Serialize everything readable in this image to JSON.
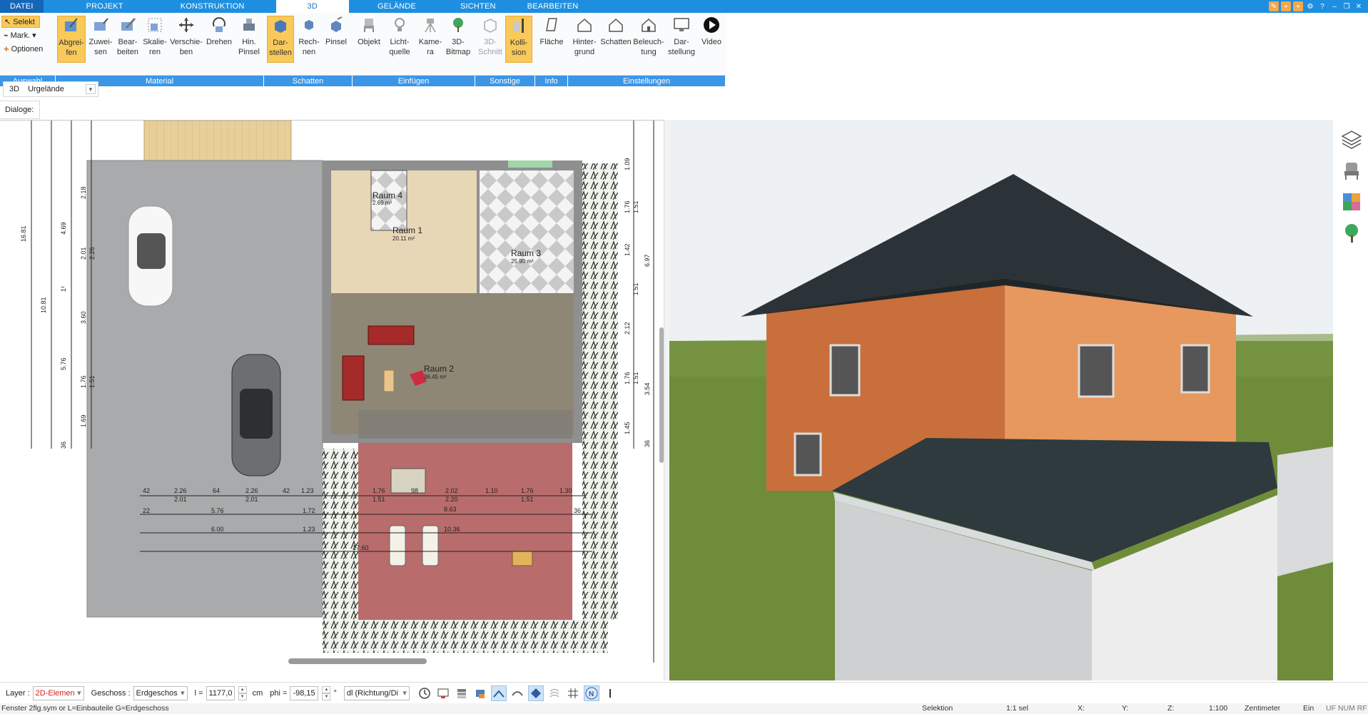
{
  "menu": {
    "tabs": [
      "DATEI",
      "PROJEKT",
      "KONSTRUKTION",
      "3D",
      "GELÄNDE",
      "SICHTEN",
      "BEARBEITEN"
    ],
    "active": "3D"
  },
  "ribbon": {
    "selection": {
      "select": "Selekt",
      "mark": "Mark.",
      "options": "Optionen"
    },
    "buttons": {
      "abgreifen": "Abgrei-\nfen",
      "zuweisen": "Zuwei-\nsen",
      "bearbeiten": "Bear-\nbeiten",
      "skalieren": "Skalie-\nren",
      "verschieben": "Verschie-\nben",
      "drehen": "Drehen",
      "hin_pinsel": "Hin.\nPinsel",
      "darstellen": "Dar-\nstellen",
      "rechnen": "Rech-\nnen",
      "pinsel": "Pinsel",
      "objekt": "Objekt",
      "lichtquelle": "Licht-\nquelle",
      "kamera": "Kame-\nra",
      "bitmap3d": "3D-\nBitmap",
      "schnitt3d": "3D-\nSchnitt",
      "kollision": "Kolli-\nsion",
      "flaeche": "Fläche",
      "hintergrund": "Hinter-\ngrund",
      "schatten": "Schatten",
      "beleuchtung": "Beleuch-\ntung",
      "darstellung": "Dar-\nstellung",
      "video": "Video"
    },
    "groups": {
      "auswahl": "Auswahl",
      "material": "Material",
      "schatten": "Schatten",
      "einfuegen": "Einfügen",
      "sonstige": "Sonstige",
      "info": "Info",
      "einstellungen": "Einstellungen"
    }
  },
  "subbar": {
    "mode": "3D",
    "terrain": "Urgelände",
    "dialoge": "Dialoge:"
  },
  "plan": {
    "rooms": [
      {
        "name": "Raum 4",
        "area": "2.69 m²"
      },
      {
        "name": "Raum 1",
        "area": "20.11 m²"
      },
      {
        "name": "Raum 3",
        "area": "25.90 m²"
      },
      {
        "name": "Raum 2",
        "area": "36.45 m²"
      }
    ],
    "dims_left": [
      "16.81",
      "10.81",
      "4.69",
      "2.01",
      "2.26",
      "1¹",
      "3.60",
      "5.76",
      "1.76",
      "1.51",
      "1.69",
      "2.18",
      "36"
    ],
    "dims_right": [
      "1.09",
      "1.76",
      "1.51",
      "1.42",
      "6.97",
      "1.51",
      "2.12",
      "1.76",
      "1.51",
      "3.54",
      "1.45",
      "36"
    ],
    "dims_bottom_row1": [
      "42",
      "2.26",
      "64",
      "2.26",
      "42",
      "1.23",
      "1.76",
      "98",
      "2.02",
      "1.10",
      "1.76",
      "1.30"
    ],
    "dims_bottom_row1b": [
      "2.01",
      "2.01",
      "1.51",
      "2.20",
      "1.51"
    ],
    "dims_bottom_row2": [
      "22",
      "5.76",
      "1.72",
      "8.63",
      "36"
    ],
    "dims_bottom_row3": [
      "6.00",
      "1.23",
      "10.36"
    ],
    "dims_bottom_row4": [
      "17.60"
    ]
  },
  "statusbar": {
    "layer_label": "Layer :",
    "layer_value": "2D-Elemen",
    "geschoss_label": "Geschoss :",
    "geschoss_value": "Erdgeschos",
    "l_label": "l =",
    "l_value": "1177,0",
    "l_unit": "cm",
    "phi_label": "phi =",
    "phi_value": "-98,15",
    "phi_unit": "°",
    "dl_value": "dl (Richtung/Di",
    "bottom_left": "Fenster 2flg.sym or L=Einbauteile G=Erdgeschoss",
    "mode": "Selektion",
    "scale_sel": "1:1 sel",
    "x_label": "X:",
    "y_label": "Y:",
    "z_label": "Z:",
    "scale": "1:100",
    "unit": "Zentimeter",
    "ein": "Ein",
    "flags": "UF NUM RF"
  },
  "colors": {
    "accent": "#1e8fe0",
    "group_bar": "#3b96e6",
    "active_button": "#f9c95a",
    "wall_orange": "#e99a5e",
    "roof": "#2d3a40",
    "grass": "#6a8a3a"
  }
}
